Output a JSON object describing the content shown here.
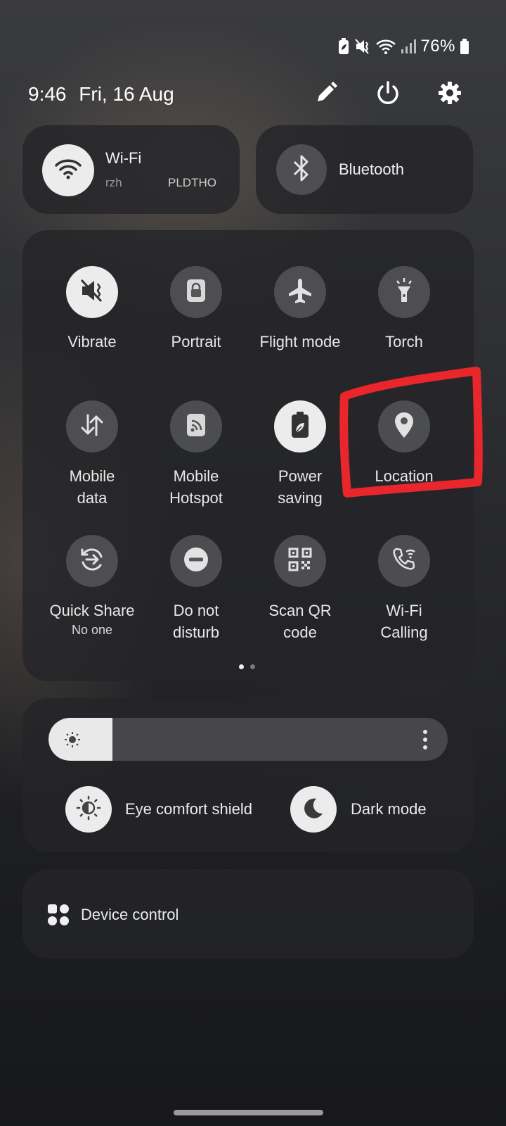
{
  "status_bar": {
    "battery_percent": "76%",
    "icons": [
      "battery-saver-icon",
      "vibrate-icon",
      "wifi-icon",
      "signal-icon",
      "battery-icon"
    ]
  },
  "header": {
    "time": "9:46",
    "date": "Fri, 16 Aug",
    "actions": [
      "edit-icon",
      "power-icon",
      "settings-icon"
    ]
  },
  "wifi_tile": {
    "label": "Wi-Fi",
    "network_left": "rzh",
    "network_right": "PLDTHO",
    "state": "on"
  },
  "bluetooth_tile": {
    "label": "Bluetooth",
    "state": "off"
  },
  "quick_tiles": [
    {
      "label": "Vibrate",
      "icon": "vibrate-icon",
      "on": true
    },
    {
      "label": "Portrait",
      "icon": "portrait-lock-icon",
      "on": false
    },
    {
      "label": "Flight mode",
      "icon": "airplane-icon",
      "on": false
    },
    {
      "label": "Torch",
      "icon": "torch-icon",
      "on": false
    },
    {
      "label": "Mobile data",
      "icon": "mobile-data-icon",
      "on": false
    },
    {
      "label": "Mobile Hotspot",
      "icon": "hotspot-icon",
      "on": false
    },
    {
      "label": "Power saving",
      "icon": "power-saving-icon",
      "on": true
    },
    {
      "label": "Location",
      "icon": "location-icon",
      "on": false
    },
    {
      "label": "Quick Share",
      "sub": "No one",
      "icon": "quick-share-icon",
      "on": false
    },
    {
      "label": "Do not disturb",
      "icon": "do-not-disturb-icon",
      "on": false
    },
    {
      "label": "Scan QR code",
      "icon": "qr-code-icon",
      "on": false
    },
    {
      "label": "Wi-Fi Calling",
      "icon": "wifi-calling-icon",
      "on": false
    }
  ],
  "pagination": {
    "pages": 2,
    "current": 1
  },
  "brightness": {
    "level": 0.16
  },
  "display_toggles": {
    "eye_comfort": "Eye comfort shield",
    "dark_mode": "Dark mode"
  },
  "device_control": {
    "label": "Device control"
  },
  "highlight": {
    "color": "#e8262b",
    "target": "Location"
  }
}
